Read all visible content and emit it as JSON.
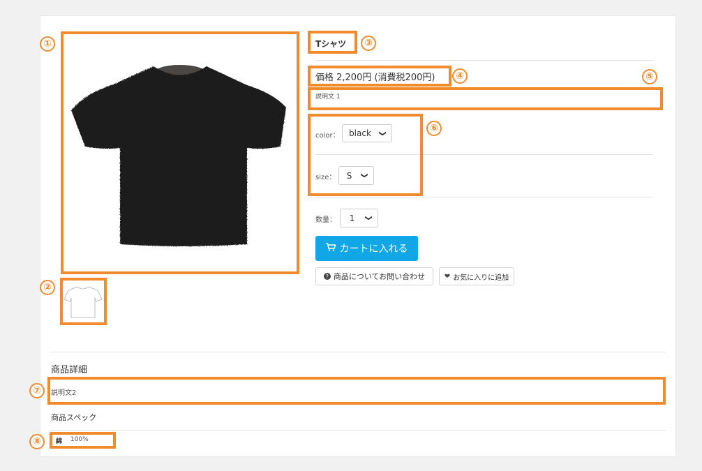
{
  "product": {
    "name": "Tシャツ",
    "price_text": "価格 2,200円 (消費税200円)",
    "description1": "説明文 1"
  },
  "options": {
    "color_label": "color：",
    "color_value": "black",
    "size_label": "size：",
    "size_value": "S"
  },
  "quantity": {
    "label": "数量：",
    "value": "1"
  },
  "buttons": {
    "cart": "カートに入れる",
    "inquiry": "商品についてお問い合わせ",
    "favorite": "お気に入りに追加"
  },
  "details": {
    "heading": "商品詳細",
    "description2": "説明文2",
    "spec_heading": "商品スペック",
    "spec_key": "綿",
    "spec_value": "100%"
  },
  "markers": [
    "①",
    "②",
    "③",
    "④",
    "⑤",
    "⑥",
    "⑦",
    "⑧"
  ],
  "colors": {
    "highlight": "#f28a2e",
    "cart_button": "#11a6e6",
    "shirt": "#1c1c1c"
  },
  "icons": {
    "cart": "cart-icon",
    "question": "question-circle-icon",
    "heart": "heart-icon",
    "chevron": "chevron-down-icon"
  }
}
